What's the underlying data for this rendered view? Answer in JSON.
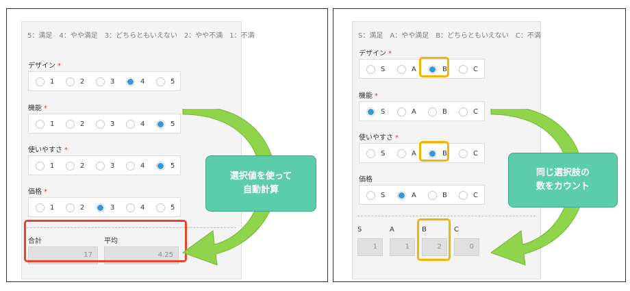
{
  "left": {
    "legend": "5：満足　4：やや満足　3：どちらともいえない　2：やや不満　1：不満",
    "fields": [
      {
        "label": "デザイン",
        "options": [
          "1",
          "2",
          "3",
          "4",
          "5"
        ],
        "selected": 3
      },
      {
        "label": "機能",
        "options": [
          "1",
          "2",
          "3",
          "4",
          "5"
        ],
        "selected": 4
      },
      {
        "label": "使いやすさ",
        "options": [
          "1",
          "2",
          "3",
          "4",
          "5"
        ],
        "selected": 4
      },
      {
        "label": "価格",
        "options": [
          "1",
          "2",
          "3",
          "4",
          "5"
        ],
        "selected": 2
      }
    ],
    "required_mark": "*",
    "totals": [
      {
        "label": "合計",
        "value": "17"
      },
      {
        "label": "平均",
        "value": "4.25"
      }
    ],
    "callout": [
      "選択値を使って",
      "自動計算"
    ]
  },
  "right": {
    "legend": "S：満足　A：やや満足　B：どちらともいえない　C：不満",
    "fields": [
      {
        "label": "デザイン",
        "options": [
          "S",
          "A",
          "B",
          "C"
        ],
        "selected": 2
      },
      {
        "label": "機能",
        "options": [
          "S",
          "A",
          "B",
          "C"
        ],
        "selected": 0
      },
      {
        "label": "使いやすさ",
        "options": [
          "S",
          "A",
          "B",
          "C"
        ],
        "selected": 2
      },
      {
        "label": "価格",
        "options": [
          "S",
          "A",
          "B",
          "C"
        ],
        "selected": 1
      }
    ],
    "required_mark": "*",
    "counts": [
      {
        "label": "S",
        "value": "1"
      },
      {
        "label": "A",
        "value": "1"
      },
      {
        "label": "B",
        "value": "2"
      },
      {
        "label": "C",
        "value": "0"
      }
    ],
    "callout": [
      "同じ選択肢の",
      "数をカウント"
    ]
  },
  "colors": {
    "accent": "#3498db",
    "highlight_orange": "#f5b400",
    "highlight_red": "#e8442a",
    "callout": "#5bcdaa",
    "arrow": "#8fd44a"
  }
}
